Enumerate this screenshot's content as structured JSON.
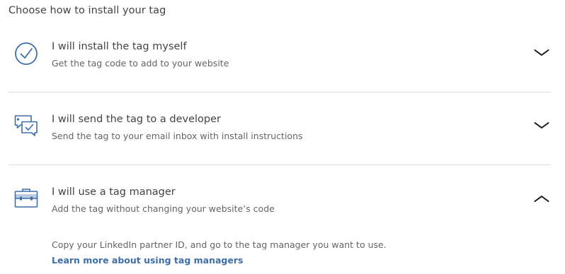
{
  "heading": "Choose how to install your tag",
  "options": [
    {
      "title": "I will install the tag myself",
      "description": "Get the tag code to add to your website",
      "icon": "check-circle-icon",
      "expanded": false
    },
    {
      "title": "I will send the tag to a developer",
      "description": "Send the tag to your email inbox with install instructions",
      "icon": "chat-check-icon",
      "expanded": false
    },
    {
      "title": "I will use a tag manager",
      "description": "Add the tag without changing your website’s code",
      "icon": "briefcase-icon",
      "expanded": true
    }
  ],
  "tag_manager_panel": {
    "instructions": "Copy your LinkedIn partner ID, and go to the tag manager you want to use.",
    "link_label": "Learn more about using tag managers"
  },
  "colors": {
    "icon_blue": "#3d6ea8",
    "link_blue": "#3d6ea8",
    "divider": "#dcdcdc"
  }
}
